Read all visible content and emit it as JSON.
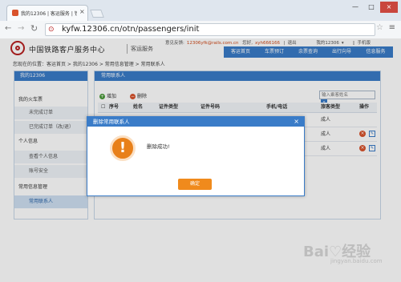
{
  "browser": {
    "tab_title": "我的12306 | 客运服务 | 铁",
    "tab_close": "×",
    "url": "kyfw.12306.cn/otn/passengers/init",
    "window_buttons": [
      "—",
      "□",
      "×"
    ]
  },
  "header": {
    "logo_text": "中国铁路客户服务中心",
    "logo_sub": "客运服务",
    "feedback_label": "意见反馈:",
    "feedback_email": "12306yfk@rails.com.cn",
    "greeting": "您好,",
    "username": "xyh666166",
    "separator": "|",
    "logout": "退出",
    "my12306": "我的12306",
    "mobile": "手机版",
    "nav": [
      "客运首页",
      "车票预订",
      "余票查询",
      "出行向导",
      "信息服务"
    ]
  },
  "breadcrumb": "您现在的位置：客运首页 > 我的12306 > 常用信息管理 > 常用联系人",
  "sidebar": {
    "title": "我的12306",
    "items": [
      {
        "label": "我的火车票",
        "kind": "group"
      },
      {
        "label": "未完成订单",
        "kind": "sub"
      },
      {
        "label": "已完成订单（改/退）",
        "kind": "sub"
      },
      {
        "label": "个人信息",
        "kind": "group"
      },
      {
        "label": "查看个人信息",
        "kind": "sub"
      },
      {
        "label": "账号安全",
        "kind": "sub"
      },
      {
        "label": "常用信息管理",
        "kind": "group"
      },
      {
        "label": "常用联系人",
        "kind": "active"
      }
    ]
  },
  "main": {
    "title": "常用联系人",
    "add_label": "增加",
    "delete_label": "删除",
    "search_placeholder": "输入乘客姓名",
    "columns": [
      "序号",
      "姓名",
      "证件类型",
      "证件号码",
      "手机/电话",
      "旅客类型",
      "操作"
    ],
    "rows": [
      {
        "type": "成人"
      },
      {
        "type": "成人"
      },
      {
        "type": "成人"
      }
    ]
  },
  "dialog": {
    "title": "删除常用联系人",
    "close": "×",
    "message": "删除成功!",
    "ok_label": "确定"
  },
  "watermark": {
    "brand": "Bai♡经验",
    "sub": "jingyan.baidu.com"
  },
  "colors": {
    "primary_blue": "#3a7cc8",
    "accent_orange": "#f08a1c",
    "danger_red": "#d9532c"
  }
}
